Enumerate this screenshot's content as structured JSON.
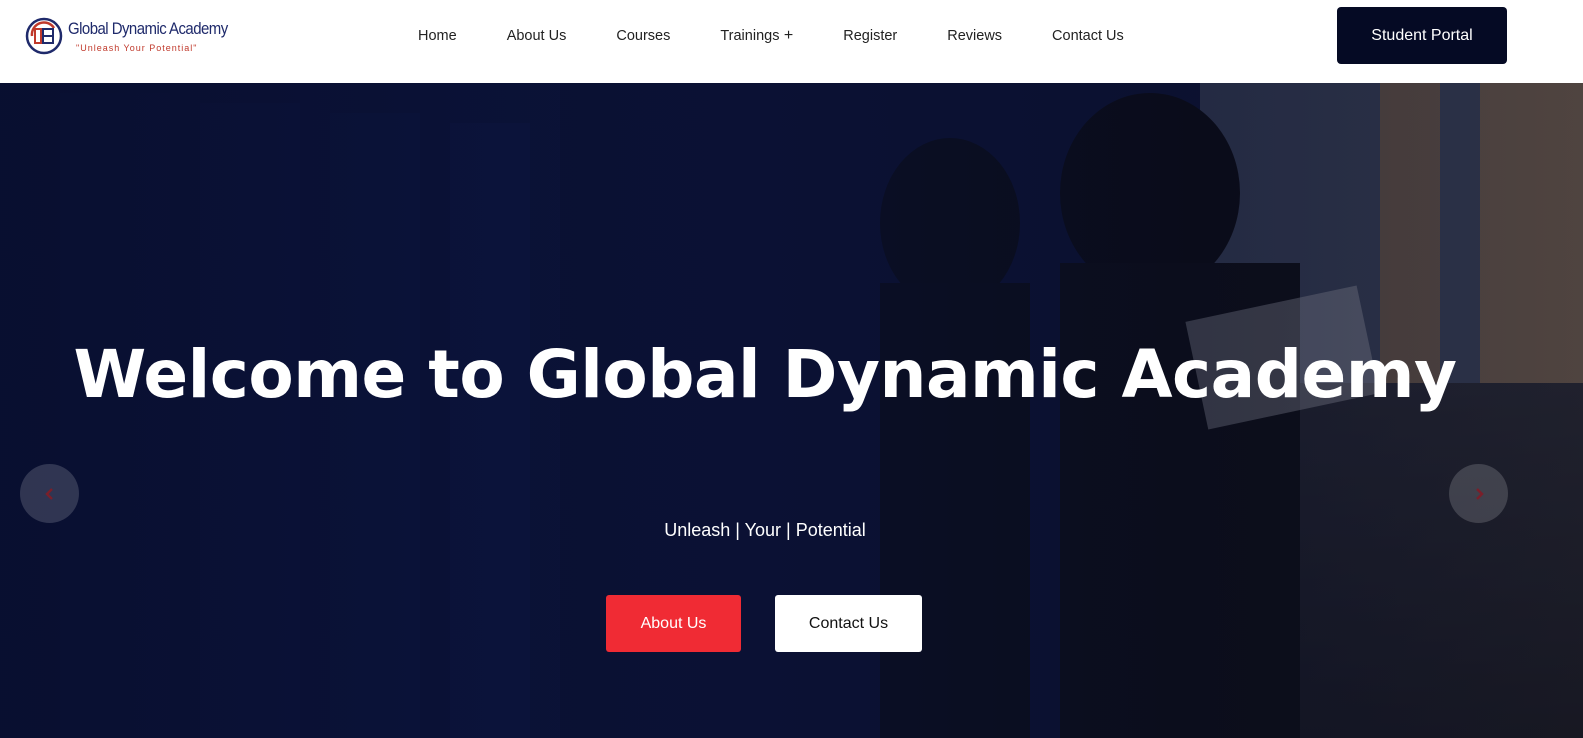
{
  "brand": {
    "name": "Global Dynamic Academy",
    "tagline": "\"Unleash Your Potential\"",
    "logo_icon": "gda-logo-icon",
    "colors": {
      "primary": "#1f2a6b",
      "accent": "#c0392b"
    }
  },
  "nav": {
    "items": [
      {
        "label": "Home"
      },
      {
        "label": "About Us"
      },
      {
        "label": "Courses"
      },
      {
        "label": "Trainings"
      },
      {
        "label": "Register"
      },
      {
        "label": "Reviews"
      },
      {
        "label": "Contact Us"
      }
    ],
    "portal_label": "Student Portal"
  },
  "hero": {
    "title": "Welcome to Global Dynamic Academy",
    "subtitle": "Unleash | Your | Potential",
    "primary_cta": "About Us",
    "secondary_cta": "Contact Us",
    "prev_icon": "chevron-left-icon",
    "next_icon": "chevron-right-icon",
    "colors": {
      "primary_cta": "#f02b34",
      "overlay": "#080e2d",
      "portal_button": "#050a24"
    }
  }
}
